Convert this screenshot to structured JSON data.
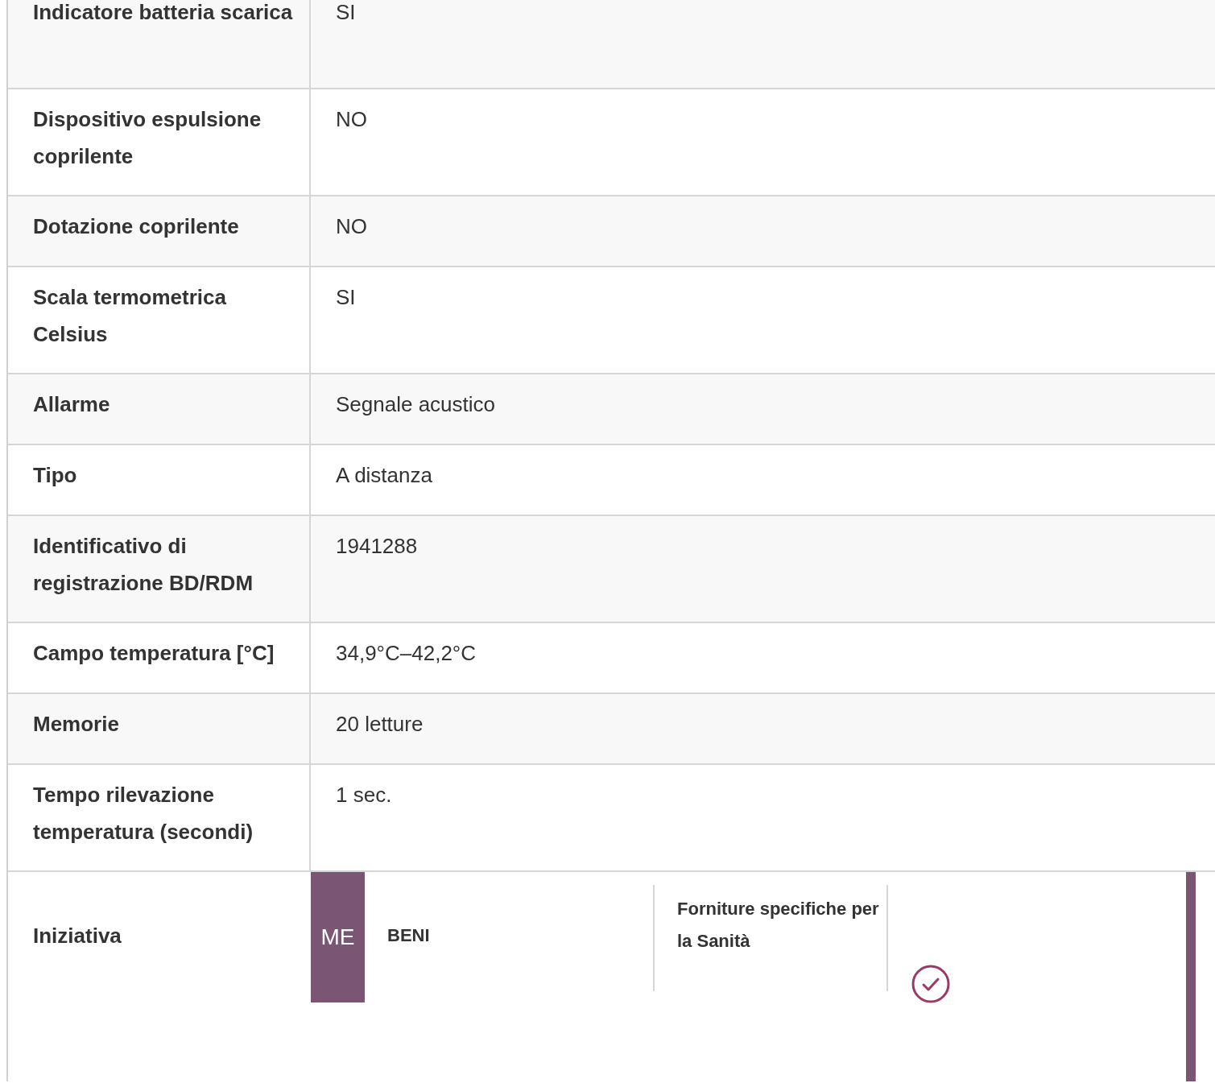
{
  "specs": [
    {
      "label": "Indicatore batteria scarica",
      "value": "SI"
    },
    {
      "label": "Dispositivo espulsione coprilente",
      "value": "NO"
    },
    {
      "label": "Dotazione coprilente",
      "value": "NO"
    },
    {
      "label": "Scala termometrica Celsius",
      "value": "SI"
    },
    {
      "label": "Allarme",
      "value": "Segnale acustico"
    },
    {
      "label": "Tipo",
      "value": "A distanza"
    },
    {
      "label": "Identificativo di registrazione BD/RDM",
      "value": "1941288"
    },
    {
      "label": "Campo temperatura [°C]",
      "value": "34,9°C–42,2°C"
    },
    {
      "label": "Memorie",
      "value": "20 letture"
    },
    {
      "label": "Tempo rilevazione temperatura (secondi)",
      "value": "1 sec."
    }
  ],
  "initiative": {
    "label": "Iniziativa",
    "code": "ME",
    "category": "BENI",
    "description": "Forniture specifiche per la Sanità"
  }
}
